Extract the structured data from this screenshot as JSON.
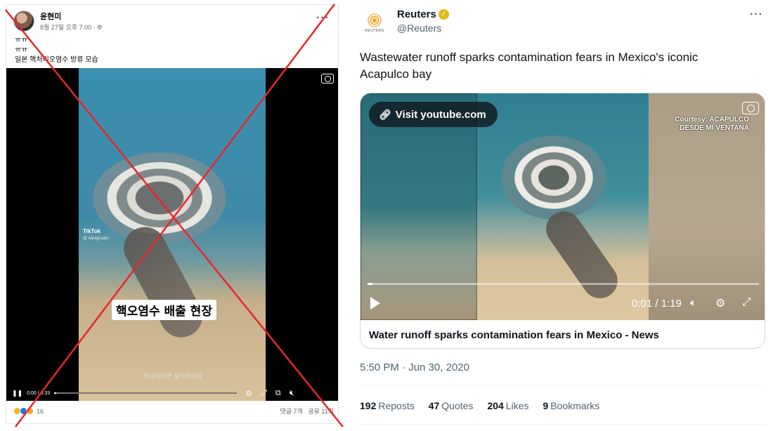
{
  "facebook_post": {
    "author": "윤현미",
    "timestamp": "8월 27일 오후 7:00 · ",
    "privacy_icon": "globe-icon",
    "more_label": "···",
    "text_lines": [
      "ㅠㅠ",
      "ㅠㅠ",
      "일본 핵처리오염수 방류 모습"
    ],
    "video": {
      "caption": "핵오염수 배출 현장",
      "subcaption": "확대하려면 클릭하세요",
      "watermark": "TikTok",
      "watermark_user": "@ nangezaici",
      "time": "0:00 / 0:33",
      "progress": 0.01
    },
    "reactions": {
      "icons": [
        "sad-reaction-icon",
        "like-reaction-icon",
        "haha-reaction-icon"
      ],
      "count": "16"
    },
    "comments": "댓글 7개",
    "shares": "공유 11회"
  },
  "overlay": {
    "mark": "red-x",
    "color": "#e8262a"
  },
  "tweet": {
    "name": "Reuters",
    "logo_text": "REUTERS",
    "verified": "✓",
    "handle": "@Reuters",
    "more_label": "···",
    "text": "Wastewater runoff sparks contamination fears in Mexico's iconic Acapulco bay",
    "card": {
      "link_label": "Visit youtube.com",
      "courtesy_line1": "Courtesy: ACAPULCO",
      "courtesy_line2": "DESDE MI VENTANA",
      "timecode": "0:01 / 1:19",
      "progress": 0.013,
      "title": "Water runoff sparks contamination fears in Mexico - News"
    },
    "timestamp": "5:50 PM · Jun 30, 2020",
    "stats": [
      {
        "count": "192",
        "label": "Reposts"
      },
      {
        "count": "47",
        "label": "Quotes"
      },
      {
        "count": "204",
        "label": "Likes"
      },
      {
        "count": "9",
        "label": "Bookmarks"
      }
    ]
  }
}
